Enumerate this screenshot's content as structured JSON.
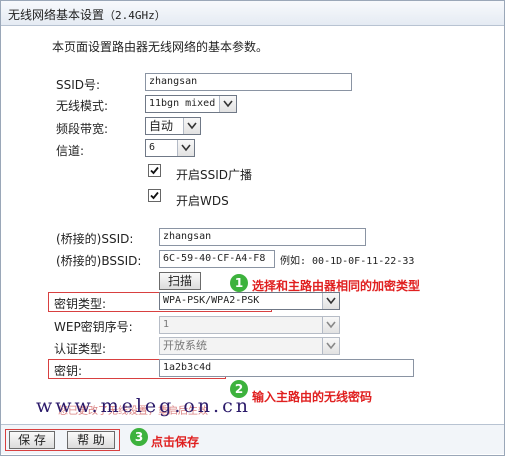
{
  "title": {
    "main": "无线网络基本设置",
    "band": "（2.4GHz）"
  },
  "intro": "本页面设置路由器无线网络的基本参数。",
  "ssid": {
    "label": "SSID号:",
    "value": "zhangsan"
  },
  "mode": {
    "label": "无线模式:",
    "value": "11bgn mixed"
  },
  "bandwidth": {
    "label": "频段带宽:",
    "value": "自动"
  },
  "channel": {
    "label": "信道:",
    "value": "6"
  },
  "checkboxes": {
    "ssid_broadcast": "开启SSID广播",
    "wds": "开启WDS"
  },
  "bridge": {
    "ssid_label": "(桥接的)SSID:",
    "ssid_value": "zhangsan",
    "bssid_label": "(桥接的)BSSID:",
    "bssid_value": "6C-59-40-CF-A4-F8",
    "example": "例如: 00-1D-0F-11-22-33",
    "scan_button": "扫描"
  },
  "key_type": {
    "label": "密钥类型:",
    "value": "WPA-PSK/WPA2-PSK"
  },
  "wep_index": {
    "label": "WEP密钥序号:",
    "value": "1"
  },
  "auth_type": {
    "label": "认证类型:",
    "value": "开放系统"
  },
  "key": {
    "label": "密钥:",
    "value": "1a2b3c4d"
  },
  "annotations": [
    {
      "num": "1",
      "text": "选择和主路由器相同的加密类型"
    },
    {
      "num": "2",
      "text": "输入主路由的无线密码"
    },
    {
      "num": "3",
      "text": "点击保存"
    }
  ],
  "watermark": "www.meleg.on.cn",
  "obscured_note": "您已更改了无线设置，重启后生效",
  "footer": {
    "save": "保 存",
    "help": "帮 助"
  },
  "colors": {
    "annotation": "#e02020",
    "badge": "#3db23d",
    "frame": "#9aa7b8"
  }
}
